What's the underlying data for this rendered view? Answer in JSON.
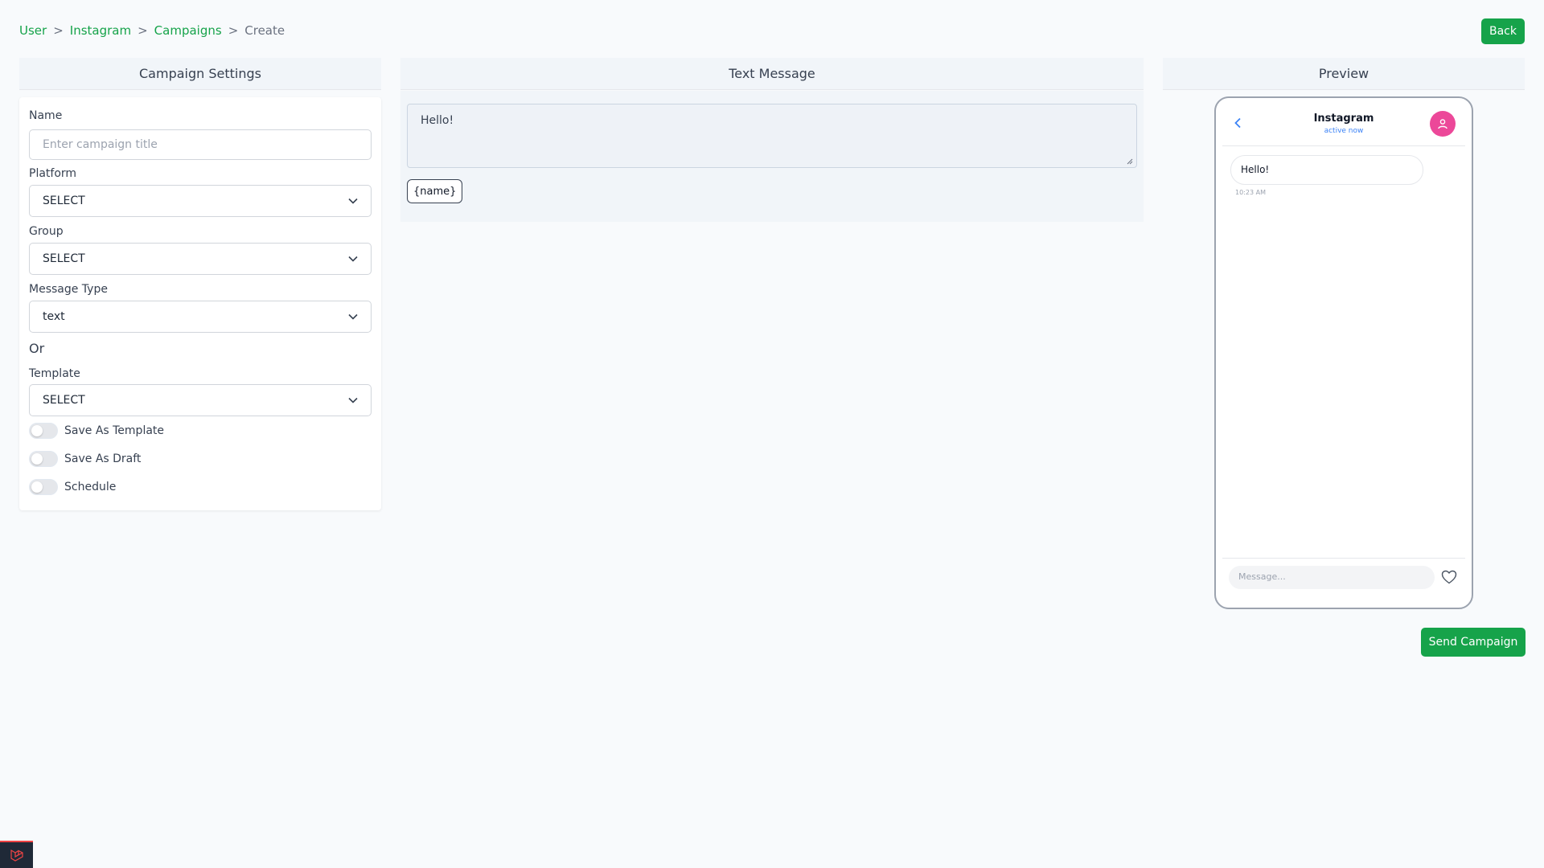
{
  "breadcrumb": {
    "items": [
      "User",
      "Instagram",
      "Campaigns"
    ],
    "separator": ">",
    "current": "Create"
  },
  "back_label": "Back",
  "columns": {
    "settings": "Campaign Settings",
    "message": "Text Message",
    "preview": "Preview"
  },
  "settings": {
    "name_label": "Name",
    "name_placeholder": "Enter campaign title",
    "platform_label": "Platform",
    "platform_value": "SELECT",
    "group_label": "Group",
    "group_value": "SELECT",
    "message_type_label": "Message Type",
    "message_type_value": "text",
    "or_text": "Or",
    "template_label": "Template",
    "template_value": "SELECT",
    "toggles": [
      {
        "label": "Save As Template",
        "on": false
      },
      {
        "label": "Save As Draft",
        "on": false
      },
      {
        "label": "Schedule",
        "on": false
      }
    ]
  },
  "message": {
    "text": "Hello!",
    "chip": "{name}"
  },
  "preview": {
    "title": "Instagram",
    "status": "active now",
    "bubble_text": "Hello!",
    "bubble_time": "10:23 AM",
    "input_placeholder": "Message..."
  },
  "send_label": "Send Campaign",
  "colors": {
    "accent": "#16a34a",
    "avatar": "#ec4899",
    "link_blue": "#3b82f6"
  }
}
